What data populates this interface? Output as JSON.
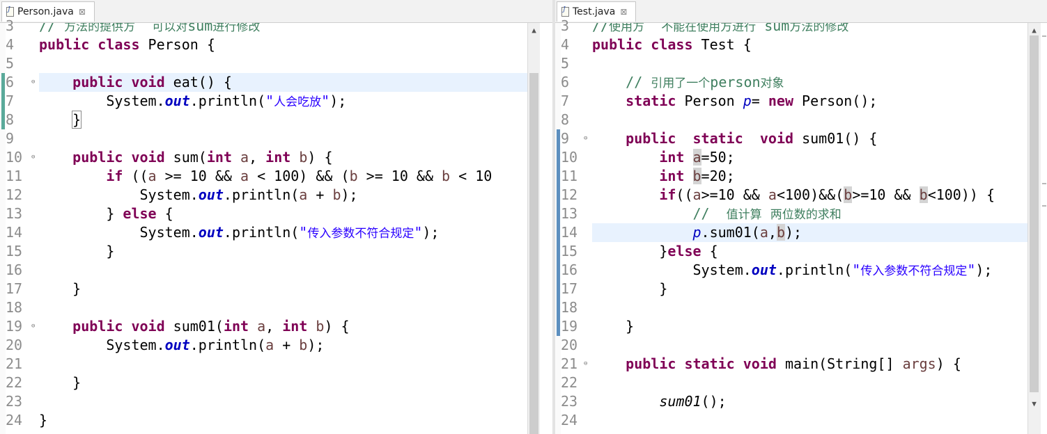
{
  "left_editor": {
    "tab_label": "Person.java",
    "close_glyph": "⊠",
    "scroll_up_glyph": "▲",
    "lines": [
      {
        "n": "3",
        "fold": false,
        "tokens": [
          {
            "t": "// 方法的提供方  可以对sum进行修改",
            "c": "cm"
          }
        ]
      },
      {
        "n": "4",
        "fold": false,
        "tokens": [
          {
            "t": "public",
            "c": "kw"
          },
          {
            "t": " "
          },
          {
            "t": "class",
            "c": "kw"
          },
          {
            "t": " Person {"
          }
        ]
      },
      {
        "n": "5",
        "fold": false,
        "tokens": []
      },
      {
        "n": "6",
        "fold": true,
        "tokens": [
          {
            "t": "    "
          },
          {
            "t": "public",
            "c": "kw"
          },
          {
            "t": " "
          },
          {
            "t": "void",
            "c": "kw"
          },
          {
            "t": " eat() {"
          }
        ]
      },
      {
        "n": "7",
        "fold": false,
        "tokens": [
          {
            "t": "        System."
          },
          {
            "t": "out",
            "c": "fi"
          },
          {
            "t": ".println("
          },
          {
            "t": "\"人会吃放\"",
            "c": "st"
          },
          {
            "t": ");"
          }
        ]
      },
      {
        "n": "8",
        "fold": false,
        "tokens": [
          {
            "t": "    "
          },
          {
            "t": "}",
            "c": "brk"
          }
        ]
      },
      {
        "n": "9",
        "fold": false,
        "tokens": []
      },
      {
        "n": "10",
        "fold": true,
        "tokens": [
          {
            "t": "    "
          },
          {
            "t": "public",
            "c": "kw"
          },
          {
            "t": " "
          },
          {
            "t": "void",
            "c": "kw"
          },
          {
            "t": " sum("
          },
          {
            "t": "int",
            "c": "kw"
          },
          {
            "t": " "
          },
          {
            "t": "a",
            "c": "pm"
          },
          {
            "t": ", "
          },
          {
            "t": "int",
            "c": "kw"
          },
          {
            "t": " "
          },
          {
            "t": "b",
            "c": "pm"
          },
          {
            "t": ") {"
          }
        ]
      },
      {
        "n": "11",
        "fold": false,
        "tokens": [
          {
            "t": "        "
          },
          {
            "t": "if",
            "c": "kw"
          },
          {
            "t": " (("
          },
          {
            "t": "a",
            "c": "pm"
          },
          {
            "t": " >= 10 && "
          },
          {
            "t": "a",
            "c": "pm"
          },
          {
            "t": " < 100) && ("
          },
          {
            "t": "b",
            "c": "pm"
          },
          {
            "t": " >= 10 && "
          },
          {
            "t": "b",
            "c": "pm"
          },
          {
            "t": " < 10"
          }
        ]
      },
      {
        "n": "12",
        "fold": false,
        "tokens": [
          {
            "t": "            System."
          },
          {
            "t": "out",
            "c": "fi"
          },
          {
            "t": ".println("
          },
          {
            "t": "a",
            "c": "pm"
          },
          {
            "t": " + "
          },
          {
            "t": "b",
            "c": "pm"
          },
          {
            "t": ");"
          }
        ]
      },
      {
        "n": "13",
        "fold": false,
        "tokens": [
          {
            "t": "        } "
          },
          {
            "t": "else",
            "c": "kw"
          },
          {
            "t": " {"
          }
        ]
      },
      {
        "n": "14",
        "fold": false,
        "tokens": [
          {
            "t": "            System."
          },
          {
            "t": "out",
            "c": "fi"
          },
          {
            "t": ".println("
          },
          {
            "t": "\"传入参数不符合规定\"",
            "c": "st"
          },
          {
            "t": ");"
          }
        ]
      },
      {
        "n": "15",
        "fold": false,
        "tokens": [
          {
            "t": "        }"
          }
        ]
      },
      {
        "n": "16",
        "fold": false,
        "tokens": []
      },
      {
        "n": "17",
        "fold": false,
        "tokens": [
          {
            "t": "    }"
          }
        ]
      },
      {
        "n": "18",
        "fold": false,
        "tokens": []
      },
      {
        "n": "19",
        "fold": true,
        "tokens": [
          {
            "t": "    "
          },
          {
            "t": "public",
            "c": "kw"
          },
          {
            "t": " "
          },
          {
            "t": "void",
            "c": "kw"
          },
          {
            "t": " sum01("
          },
          {
            "t": "int",
            "c": "kw"
          },
          {
            "t": " "
          },
          {
            "t": "a",
            "c": "pm"
          },
          {
            "t": ", "
          },
          {
            "t": "int",
            "c": "kw"
          },
          {
            "t": " "
          },
          {
            "t": "b",
            "c": "pm"
          },
          {
            "t": ") {"
          }
        ]
      },
      {
        "n": "20",
        "fold": false,
        "tokens": [
          {
            "t": "        System."
          },
          {
            "t": "out",
            "c": "fi"
          },
          {
            "t": ".println("
          },
          {
            "t": "a",
            "c": "pm"
          },
          {
            "t": " + "
          },
          {
            "t": "b",
            "c": "pm"
          },
          {
            "t": ");"
          }
        ]
      },
      {
        "n": "21",
        "fold": false,
        "tokens": []
      },
      {
        "n": "22",
        "fold": false,
        "tokens": [
          {
            "t": "    }"
          }
        ]
      },
      {
        "n": "23",
        "fold": false,
        "tokens": []
      },
      {
        "n": "24",
        "fold": false,
        "tokens": [
          {
            "t": "}"
          }
        ]
      }
    ]
  },
  "right_editor": {
    "tab_label": "Test.java",
    "close_glyph": "⊠",
    "scroll_up_glyph": "▲",
    "scroll_down_glyph": "▼",
    "lines": [
      {
        "n": "3",
        "fold": false,
        "tokens": [
          {
            "t": "//使用方  不能在使用方进行 sum方法的修改",
            "c": "cm"
          }
        ]
      },
      {
        "n": "4",
        "fold": false,
        "tokens": [
          {
            "t": "public",
            "c": "kw"
          },
          {
            "t": " "
          },
          {
            "t": "class",
            "c": "kw"
          },
          {
            "t": " Test {"
          }
        ]
      },
      {
        "n": "5",
        "fold": false,
        "tokens": []
      },
      {
        "n": "6",
        "fold": false,
        "tokens": [
          {
            "t": "    "
          },
          {
            "t": "// 引用了一个person对象",
            "c": "cm"
          }
        ]
      },
      {
        "n": "7",
        "fold": false,
        "tokens": [
          {
            "t": "    "
          },
          {
            "t": "static",
            "c": "kw"
          },
          {
            "t": " Person "
          },
          {
            "t": "p",
            "c": "sv"
          },
          {
            "t": "= "
          },
          {
            "t": "new",
            "c": "kw"
          },
          {
            "t": " Person();"
          }
        ]
      },
      {
        "n": "8",
        "fold": false,
        "tokens": []
      },
      {
        "n": "9",
        "fold": true,
        "tokens": [
          {
            "t": "    "
          },
          {
            "t": "public",
            "c": "kw"
          },
          {
            "t": "  "
          },
          {
            "t": "static",
            "c": "kw"
          },
          {
            "t": "  "
          },
          {
            "t": "void",
            "c": "kw"
          },
          {
            "t": " sum01() {"
          }
        ]
      },
      {
        "n": "10",
        "fold": false,
        "tokens": [
          {
            "t": "        "
          },
          {
            "t": "int",
            "c": "kw"
          },
          {
            "t": " "
          },
          {
            "t": "a",
            "c": "lvh"
          },
          {
            "t": "=50;"
          }
        ]
      },
      {
        "n": "11",
        "fold": false,
        "tokens": [
          {
            "t": "        "
          },
          {
            "t": "int",
            "c": "kw"
          },
          {
            "t": " "
          },
          {
            "t": "b",
            "c": "lvh"
          },
          {
            "t": "=20;"
          }
        ]
      },
      {
        "n": "12",
        "fold": false,
        "tokens": [
          {
            "t": "        "
          },
          {
            "t": "if",
            "c": "kw"
          },
          {
            "t": "(("
          },
          {
            "t": "a",
            "c": "lv"
          },
          {
            "t": ">=10 && "
          },
          {
            "t": "a",
            "c": "lv"
          },
          {
            "t": "<100)&&("
          },
          {
            "t": "b",
            "c": "lvh"
          },
          {
            "t": ">=10 && "
          },
          {
            "t": "b",
            "c": "lvh"
          },
          {
            "t": "<100)) {"
          }
        ]
      },
      {
        "n": "13",
        "fold": false,
        "tokens": [
          {
            "t": "            "
          },
          {
            "t": "//  值计算 两位数的求和",
            "c": "cm"
          }
        ]
      },
      {
        "n": "14",
        "fold": false,
        "tokens": [
          {
            "t": "            "
          },
          {
            "t": "p",
            "c": "sv"
          },
          {
            "t": ".sum01("
          },
          {
            "t": "a",
            "c": "lv"
          },
          {
            "t": ","
          },
          {
            "t": "b",
            "c": "lvh"
          },
          {
            "t": ");"
          }
        ]
      },
      {
        "n": "15",
        "fold": false,
        "tokens": [
          {
            "t": "        }"
          },
          {
            "t": "else",
            "c": "kw"
          },
          {
            "t": " {"
          }
        ]
      },
      {
        "n": "16",
        "fold": false,
        "tokens": [
          {
            "t": "            System."
          },
          {
            "t": "out",
            "c": "fi"
          },
          {
            "t": ".println("
          },
          {
            "t": "\"传入参数不符合规定\"",
            "c": "st"
          },
          {
            "t": ");"
          }
        ]
      },
      {
        "n": "17",
        "fold": false,
        "tokens": [
          {
            "t": "        }"
          }
        ]
      },
      {
        "n": "18",
        "fold": false,
        "tokens": []
      },
      {
        "n": "19",
        "fold": false,
        "tokens": [
          {
            "t": "    }"
          }
        ]
      },
      {
        "n": "20",
        "fold": false,
        "tokens": []
      },
      {
        "n": "21",
        "fold": true,
        "tokens": [
          {
            "t": "    "
          },
          {
            "t": "public",
            "c": "kw"
          },
          {
            "t": " "
          },
          {
            "t": "static",
            "c": "kw"
          },
          {
            "t": " "
          },
          {
            "t": "void",
            "c": "kw"
          },
          {
            "t": " main(String[] "
          },
          {
            "t": "args",
            "c": "pm"
          },
          {
            "t": ") {"
          }
        ]
      },
      {
        "n": "22",
        "fold": false,
        "tokens": []
      },
      {
        "n": "23",
        "fold": false,
        "tokens": [
          {
            "t": "        "
          },
          {
            "t": "sum01",
            "c": "it"
          },
          {
            "t": "();"
          }
        ]
      },
      {
        "n": "24",
        "fold": false,
        "tokens": []
      }
    ]
  },
  "colors": {
    "keyword": "#7f0055",
    "comment": "#3f7f5f",
    "string": "#2a00ff",
    "field": "#0000c0",
    "local": "#6a3e3e",
    "current_line": "#e8f2fe"
  }
}
